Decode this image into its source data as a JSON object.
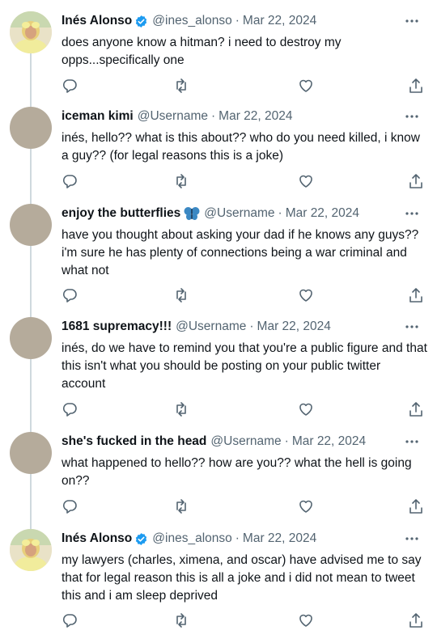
{
  "tweets": [
    {
      "name": "Inés Alonso",
      "handle": "@ines_alonso",
      "sep": "·",
      "date": "Mar 22, 2024",
      "verified": true,
      "text": "does anyone know a hitman? i need to destroy my opps...specifically one"
    },
    {
      "name": "iceman kimi",
      "handle": "@Username",
      "sep": "·",
      "date": "Mar 22, 2024",
      "text": "inés, hello?? what is this about?? who do you need killed, i know a guy?? (for legal reasons this is a joke)"
    },
    {
      "name": "enjoy the butterflies",
      "name_emoji": "butterfly",
      "handle": "@Username",
      "sep": "·",
      "date": "Mar 22, 2024",
      "text": "have you thought about asking your dad if he knows any guys?? i'm sure he has plenty of connections being a war criminal and what not"
    },
    {
      "name": "1681 supremacy!!!",
      "handle": "@Username",
      "sep": "·",
      "date": "Mar 22, 2024",
      "text": "inés, do we have to remind you that you're a public figure and that this isn't what you should be posting on your public twitter account"
    },
    {
      "name": "she's fucked in the head",
      "handle": "@Username",
      "sep": "·",
      "date": "Mar 22, 2024",
      "text": "what happened to hello?? how are you?? what the hell is going on??"
    },
    {
      "name": "Inés Alonso",
      "handle": "@ines_alonso",
      "sep": "·",
      "date": "Mar 22, 2024",
      "verified": true,
      "text": "my lawyers (charles, ximena, and oscar) have advised me to say that for legal reason this is all a joke and i did not mean to tweet this and i am sleep deprived"
    }
  ],
  "icons": {
    "more": "more-dots-icon",
    "reply": "reply-icon",
    "retweet": "retweet-icon",
    "like": "heart-icon",
    "share": "share-icon",
    "verified": "verified-badge-icon"
  },
  "colors": {
    "text": "#0f1419",
    "secondary": "#536471",
    "thread_line": "#cfd9de",
    "verified": "#1d9bf0",
    "butterfly": "#3b88c3"
  }
}
